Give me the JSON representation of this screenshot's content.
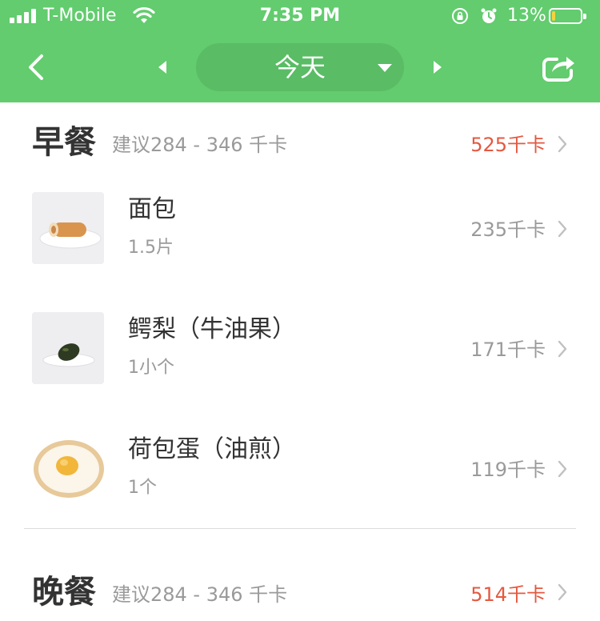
{
  "status_bar": {
    "carrier": "T-Mobile",
    "time": "7:35 PM",
    "battery_percent": "13%",
    "battery_level": 0.13,
    "icons": [
      "signal-icon",
      "wifi-icon",
      "orientation-lock-icon",
      "alarm-icon",
      "battery-icon"
    ]
  },
  "nav": {
    "date_label": "今天",
    "icons": [
      "back-icon",
      "prev-day-icon",
      "dropdown-caret-icon",
      "next-day-icon",
      "share-icon"
    ]
  },
  "colors": {
    "header_bg": "#62cc6e",
    "accent_red": "#e5583f",
    "text_dark": "#333333",
    "text_gray": "#9a9a9a",
    "battery_fill": "#f7d23b"
  },
  "meals": [
    {
      "title": "早餐",
      "suggest": "建议284 - 346 千卡",
      "total": "525千卡",
      "items": [
        {
          "name": "面包",
          "amount": "1.5片",
          "kcal": "235千卡",
          "image": "bread-roll-image"
        },
        {
          "name": "鳄梨（牛油果）",
          "amount": "1小个",
          "kcal": "171千卡",
          "image": "avocado-image"
        },
        {
          "name": "荷包蛋（油煎）",
          "amount": "1个",
          "kcal": "119千卡",
          "image": "fried-egg-image"
        }
      ]
    },
    {
      "title": "晚餐",
      "suggest": "建议284 - 346 千卡",
      "total": "514千卡",
      "items": []
    }
  ]
}
